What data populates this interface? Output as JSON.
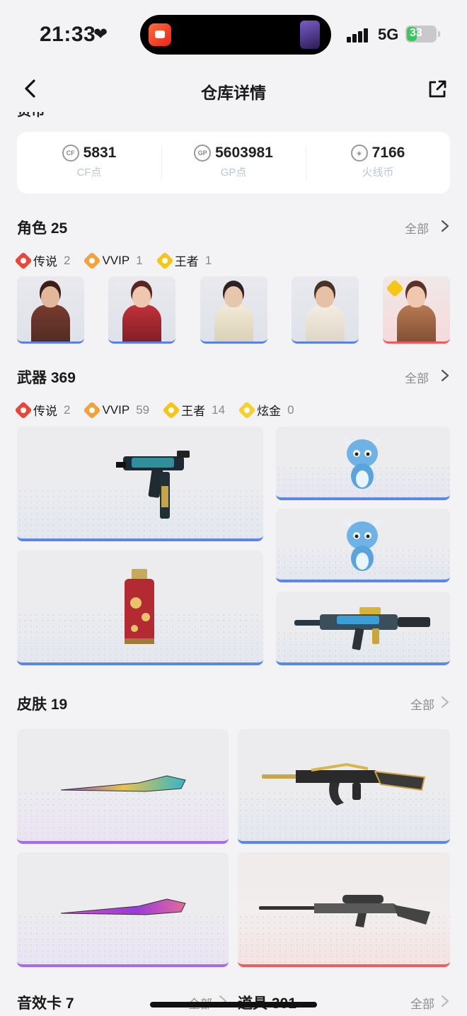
{
  "status": {
    "time": "21:33",
    "network": "5G",
    "battery": "33"
  },
  "nav": {
    "title": "仓库详情"
  },
  "currency": {
    "section_title_cut": "货币",
    "items": [
      {
        "value": "5831",
        "label": "CF点"
      },
      {
        "value": "5603981",
        "label": "GP点"
      },
      {
        "value": "7166",
        "label": "火线币"
      }
    ]
  },
  "characters": {
    "title": "角色 25",
    "all": "全部",
    "tiers": [
      {
        "name": "传说",
        "count": "2"
      },
      {
        "name": "VVIP",
        "count": "1"
      },
      {
        "name": "王者",
        "count": "1"
      }
    ]
  },
  "weapons": {
    "title": "武器 369",
    "all": "全部",
    "tiers": [
      {
        "name": "传说",
        "count": "2"
      },
      {
        "name": "VVIP",
        "count": "59"
      },
      {
        "name": "王者",
        "count": "14"
      },
      {
        "name": "炫金",
        "count": "0"
      }
    ]
  },
  "skins": {
    "title": "皮肤 19",
    "all": "全部"
  },
  "sound_cards": {
    "title": "音效卡 7",
    "all": "全部"
  },
  "props": {
    "title": "道具 301",
    "all": "全部"
  },
  "colors": {
    "accent_blue": "#5b87ea",
    "legend_red": "#e8483a",
    "vvip_orange": "#f2a23a",
    "king_yellow": "#f5c518"
  }
}
